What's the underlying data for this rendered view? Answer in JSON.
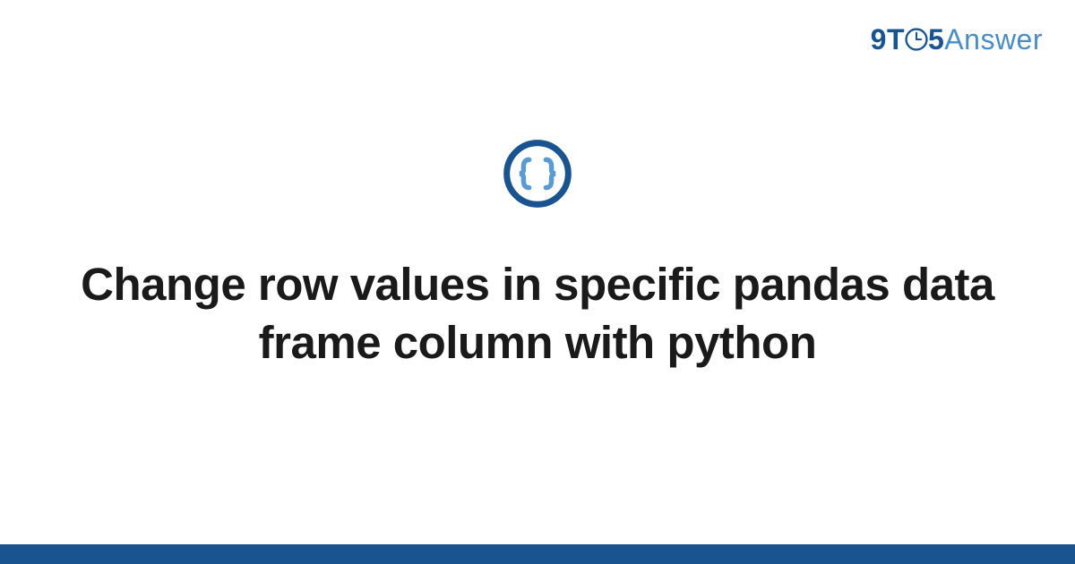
{
  "header": {
    "logo_9": "9",
    "logo_t": "T",
    "logo_5": "5",
    "logo_answer": "Answer"
  },
  "icon": {
    "name": "code-braces-icon"
  },
  "title": "Change row values in specific pandas data frame column with python",
  "colors": {
    "primary": "#1a5490",
    "secondary": "#4a8cc7",
    "text": "#1a1a1a"
  }
}
